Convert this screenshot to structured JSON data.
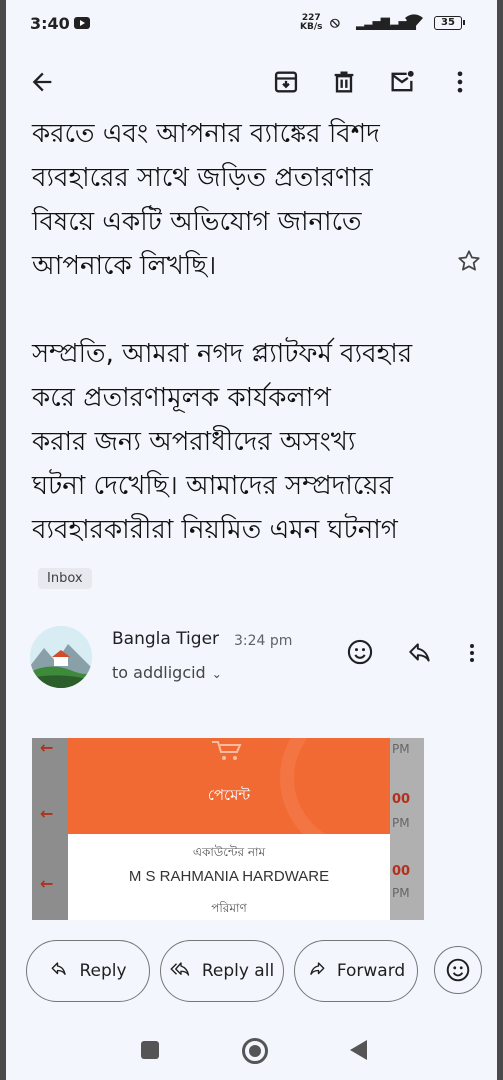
{
  "status_bar": {
    "time": "3:40",
    "net_speed_top": "227",
    "net_speed_bottom": "KB/s",
    "battery": "35"
  },
  "email": {
    "body_paragraphs": [
      "করতে এবং আপনার ব্যাঙ্কের বিশদ ব্যবহারের সাথে জড়িত প্রতারণার বিষয়ে একটি অভিযোগ জানাতে আপনাকে লিখছি।",
      "সম্প্রতি, আমরা নগদ প্ল্যাটফর্ম ব্যবহার করে প্রতারণামূলক কার্যকলাপ করার জন্য অপরাধীদের অসংখ্য ঘটনা দেখেছি। আমাদের সম্প্রদায়ের ব্যবহারকারীরা নিয়মিত এমন ঘটনাগ"
    ],
    "body_lines_1": [
      "করতে এবং আপনার ব্যাঙ্কের বিশদ",
      "ব্যবহারের সাথে জড়িত প্রতারণার",
      "বিষয়ে একটি অভিযোগ জানাতে",
      "আপনাকে লিখছি।"
    ],
    "body_lines_2": [
      "সম্প্রতি, আমরা নগদ প্ল্যাটফর্ম ব্যবহার",
      "করে প্রতারণামূলক কার্যকলাপ",
      "করার জন্য অপরাধীদের অসংখ্য",
      "ঘটনা দেখেছি। আমাদের সম্প্রদায়ের",
      "ব্যবহারকারীরা নিয়মিত এমন ঘটনাগ"
    ],
    "label_chip": "Inbox"
  },
  "sender": {
    "name": "Bangla Tiger",
    "time": "3:24 pm",
    "to": "to addligcid"
  },
  "preview": {
    "title": "পেমেন্ট",
    "account_label": "একাউন্টের নাম",
    "account_name": "M S RAHMANIA HARDWARE",
    "amount_label": "পরিমাণ",
    "side_texts": [
      "PM",
      "00",
      "PM",
      "00",
      "PM"
    ]
  },
  "actions": {
    "reply": "Reply",
    "reply_all": "Reply all",
    "forward": "Forward"
  },
  "colors": {
    "background": "#f3f6fc",
    "payment_orange": "#f26a33",
    "pill_border": "#747775"
  }
}
